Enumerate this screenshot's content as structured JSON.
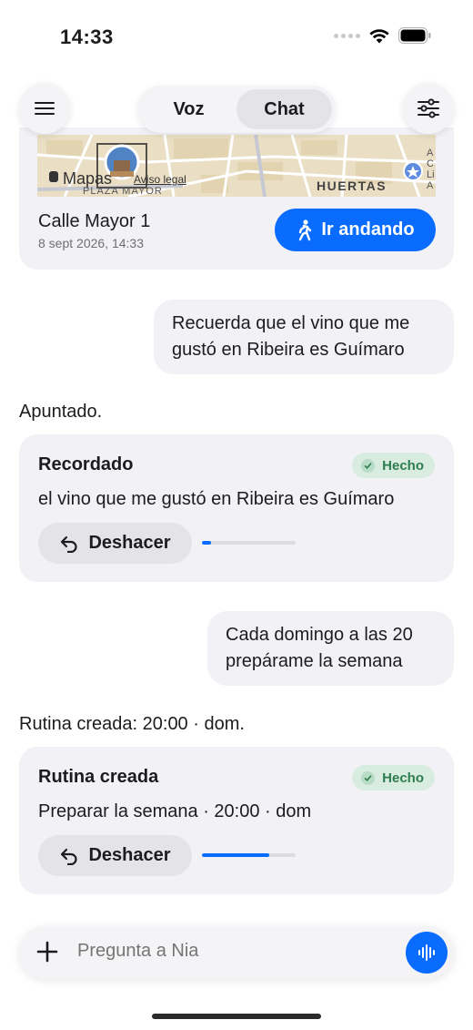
{
  "status": {
    "time": "14:33"
  },
  "nav": {
    "menu_icon": "hamburger-icon",
    "tabs": [
      {
        "label": "Voz",
        "active": false
      },
      {
        "label": "Chat",
        "active": true
      }
    ],
    "settings_icon": "sliders-icon"
  },
  "map_card": {
    "map_labels": {
      "brand": "Mapas",
      "legal": "Aviso legal",
      "district": "PLAZA MAYOR",
      "area": "HUERTAS",
      "edge": "A\nC\nLi\nA"
    },
    "place": "Calle Mayor 1",
    "date": "8 sept 2026, 14:33",
    "walk_button": "Ir andando"
  },
  "messages": {
    "user_1": "Recuerda que el vino que me gustó en Ribeira es Guímaro",
    "assistant_1": "Apuntado.",
    "card_1": {
      "title": "Recordado",
      "badge": "Hecho",
      "body": "el vino que me gustó en Ribeira es Guímaro",
      "undo": "Deshacer",
      "progress": 0.1
    },
    "user_2": "Cada domingo a las 20 prepárame la semana",
    "assistant_2": "Rutina creada: 20:00 · dom.",
    "card_2": {
      "title": "Rutina creada",
      "badge": "Hecho",
      "body": "Preparar la semana · 20:00 · dom",
      "undo": "Deshacer",
      "progress": 0.72
    }
  },
  "input": {
    "placeholder": "Pregunta a Nia"
  },
  "colors": {
    "accent": "#0a6cff",
    "bubble": "#f2f2f6",
    "done_bg": "#d8ece0",
    "done_text": "#2e7d4f"
  }
}
